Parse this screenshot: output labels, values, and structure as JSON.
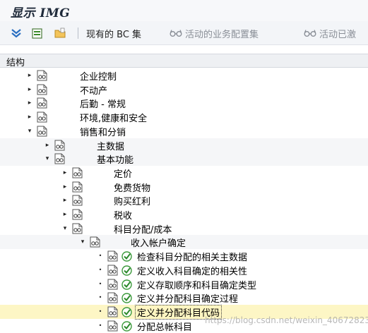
{
  "window": {
    "title": "显示 IMG"
  },
  "toolbar": {
    "buttons": [
      {
        "icon": "expand-all-icon"
      },
      {
        "icon": "collapse-icon"
      },
      {
        "icon": "folder-icon"
      }
    ],
    "bc_sets_label": "现有的 BC 集",
    "activity_config_label": "活动的业务配置集",
    "activity_done_label": "活动已激"
  },
  "section": {
    "label": "结构"
  },
  "tree": {
    "nodes": [
      {
        "label": "企业控制",
        "toggle": "collapsed"
      },
      {
        "label": "不动产",
        "toggle": "collapsed"
      },
      {
        "label": "后勤 - 常规",
        "toggle": "collapsed"
      },
      {
        "label": "环境,健康和安全",
        "toggle": "collapsed"
      },
      {
        "label": "销售和分销",
        "toggle": "expanded"
      },
      {
        "label": "主数据",
        "toggle": "collapsed"
      },
      {
        "label": "基本功能",
        "toggle": "expanded"
      },
      {
        "label": "定价",
        "toggle": "collapsed"
      },
      {
        "label": "免费货物",
        "toggle": "collapsed"
      },
      {
        "label": "购买红利",
        "toggle": "collapsed"
      },
      {
        "label": "税收",
        "toggle": "collapsed"
      },
      {
        "label": "科目分配/成本",
        "toggle": "expanded"
      },
      {
        "label": "收入帐户确定",
        "toggle": "expanded"
      },
      {
        "label": "检查科目分配的相关主数据",
        "toggle": "leaf"
      },
      {
        "label": "定义收入科目确定的相关性",
        "toggle": "leaf"
      },
      {
        "label": "定义存取顺序和科目确定类型",
        "toggle": "leaf"
      },
      {
        "label": "定义并分配科目确定过程",
        "toggle": "leaf"
      },
      {
        "label": "定义并分配科目代码",
        "toggle": "leaf",
        "selected": true
      },
      {
        "label": "分配总帐科目",
        "toggle": "leaf"
      }
    ]
  },
  "watermark": "https://blog.csdn.net/weixin_40672823",
  "colors": {
    "selection": "#fdf6c5",
    "exec_icon_green": "#3c9a3c",
    "toolbar_bg": "#f3f5f8"
  }
}
